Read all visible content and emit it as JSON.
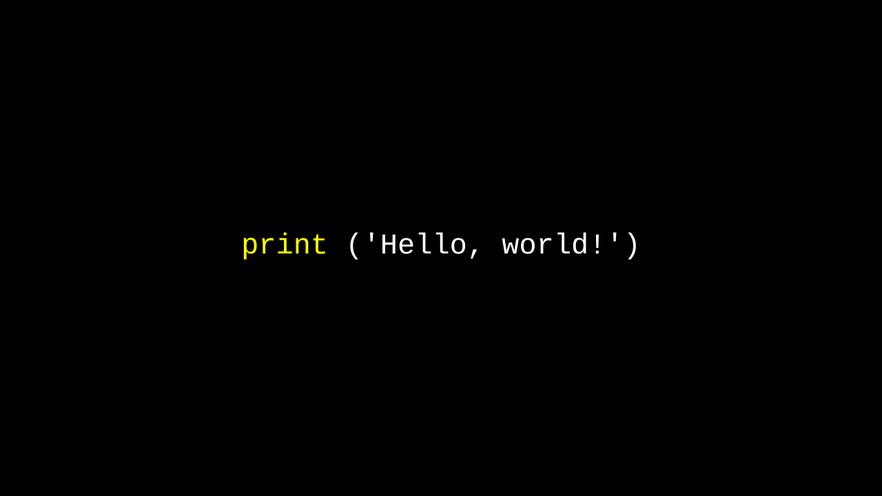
{
  "code": {
    "keyword": "print",
    "space": " ",
    "open_paren": "(",
    "quote_open": "'",
    "string_content": "Hello, world!",
    "quote_close": "'",
    "close_paren": ")"
  },
  "colors": {
    "background": "#000000",
    "keyword": "#ffff00",
    "plain": "#ffffff"
  }
}
